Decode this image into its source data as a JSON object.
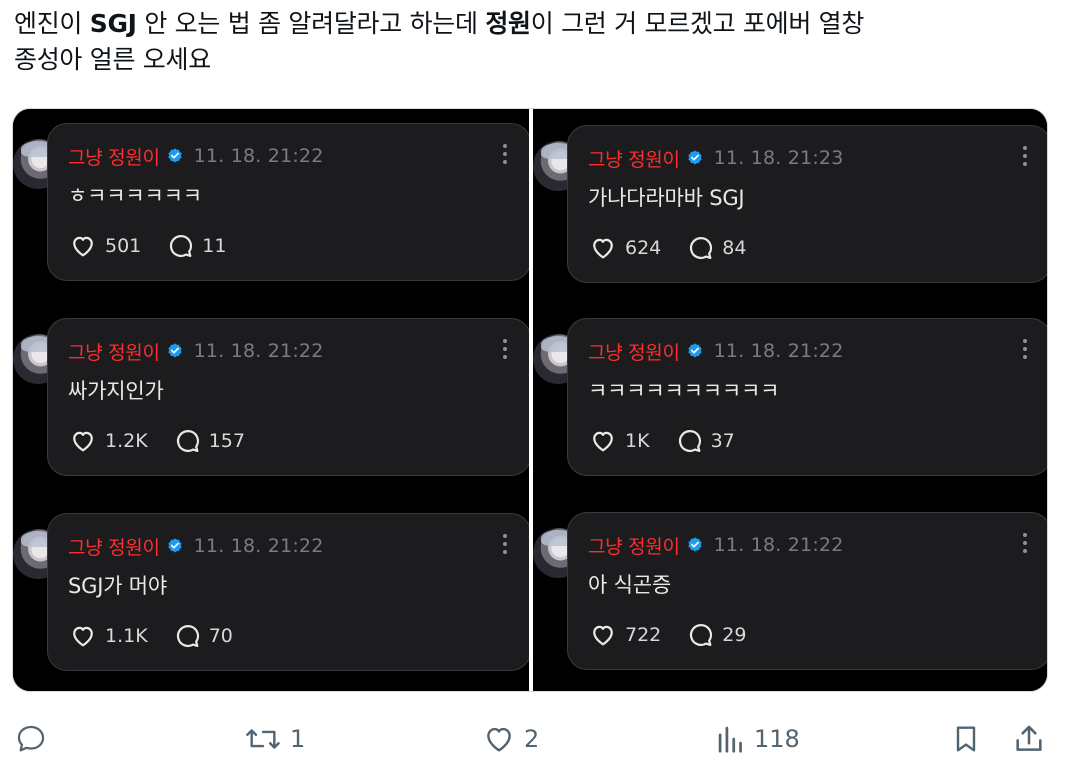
{
  "tweet": {
    "line1_a": "엔진이 ",
    "line1_b": "SGJ",
    "line1_c": " 안 오는 법 좀 알려달라고 하는데 ",
    "line1_d": "정원",
    "line1_e": "이 그런 거 모르겠고 포에버 열창",
    "line2": "종성아 얼른 오세요"
  },
  "media": {
    "left_posts": [
      {
        "author": "그냥 정원이",
        "time": "11. 18. 21:22",
        "text": "ㅎㅋㅋㅋㅋㅋㅋ",
        "likes": "501",
        "replies": "11"
      },
      {
        "author": "그냥 정원이",
        "time": "11. 18. 21:22",
        "text": "싸가지인가",
        "likes": "1.2K",
        "replies": "157"
      },
      {
        "author": "그냥 정원이",
        "time": "11. 18. 21:22",
        "text": "SGJ가 머야",
        "likes": "1.1K",
        "replies": "70"
      }
    ],
    "right_posts": [
      {
        "author": "그냥 정원이",
        "time": "11. 18. 21:23",
        "text": "가나다라마바 SGJ",
        "likes": "624",
        "replies": "84"
      },
      {
        "author": "그냥 정원이",
        "time": "11. 18. 21:22",
        "text": "ㅋㅋㅋㅋㅋㅋㅋㅋㅋㅋ",
        "likes": "1K",
        "replies": "37"
      },
      {
        "author": "그냥 정원이",
        "time": "11. 18. 21:22",
        "text": "아 식곤증",
        "likes": "722",
        "replies": "29"
      }
    ]
  },
  "actions": {
    "reply_icon": "speech-bubble-icon",
    "retweet_count": "1",
    "like_count": "2",
    "views_count": "118",
    "bookmark_icon": "bookmark-icon",
    "share_icon": "share-icon"
  },
  "colors": {
    "author_red": "#ff2d2d",
    "verified_blue": "#1d9bf0",
    "card_bg": "#1c1c1e",
    "action_gray": "#536471"
  }
}
